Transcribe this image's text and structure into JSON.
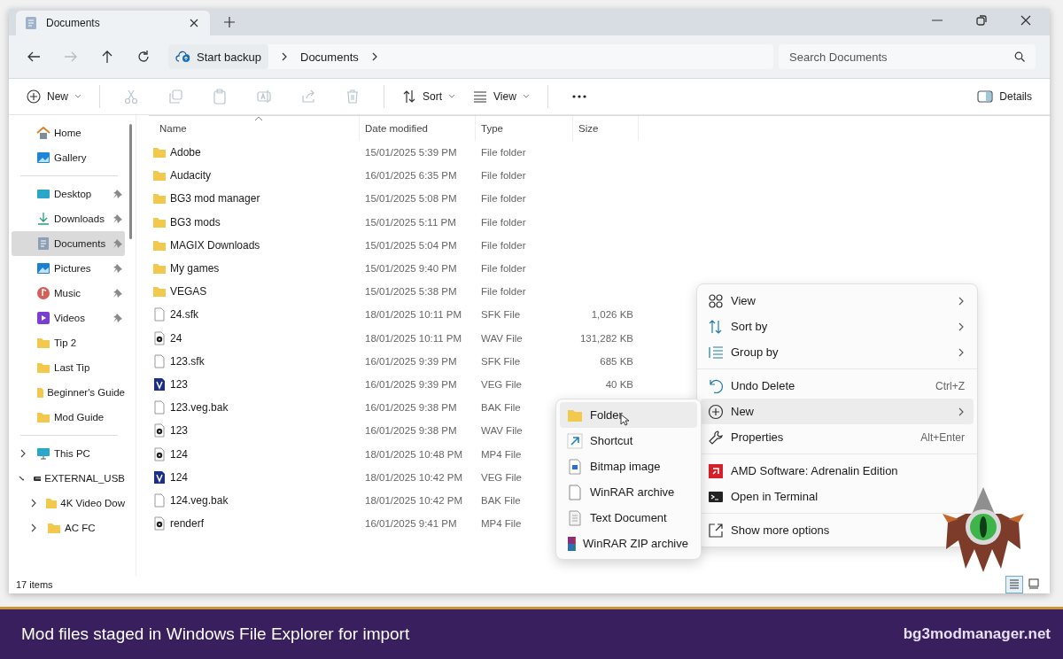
{
  "window": {
    "tabs": [
      {
        "label": "Documents",
        "selected": true
      }
    ]
  },
  "address": {
    "backup": "Start backup",
    "breadcrumbs": [
      "Documents"
    ],
    "search": {
      "placeholder": "Search Documents"
    }
  },
  "toolbar": {
    "new": "New",
    "actions": [
      {
        "kind": "cut",
        "disabled": true
      },
      {
        "kind": "copy",
        "disabled": true
      },
      {
        "kind": "paste",
        "disabled": true
      },
      {
        "kind": "rename",
        "disabled": true
      },
      {
        "kind": "share",
        "disabled": true
      },
      {
        "kind": "delete",
        "disabled": true
      }
    ],
    "sort": "Sort",
    "view": "View",
    "details": "Details"
  },
  "sidebar": {
    "groups": [
      [
        {
          "label": "Home",
          "kind": "home",
          "pinned": false,
          "selected": false
        },
        {
          "label": "Gallery",
          "kind": "gallery",
          "pinned": false,
          "selected": false
        }
      ],
      [
        {
          "label": "Desktop",
          "kind": "desktop",
          "pinned": true,
          "selected": false
        },
        {
          "label": "Downloads",
          "kind": "downloads",
          "pinned": true,
          "selected": false
        },
        {
          "label": "Documents",
          "kind": "documents",
          "pinned": true,
          "selected": true
        },
        {
          "label": "Pictures",
          "kind": "pictures",
          "pinned": true,
          "selected": false
        },
        {
          "label": "Music",
          "kind": "music",
          "pinned": true,
          "selected": false
        },
        {
          "label": "Videos",
          "kind": "videos",
          "pinned": true,
          "selected": false
        },
        {
          "label": "Tip 2",
          "kind": "folder",
          "pinned": false,
          "selected": false
        },
        {
          "label": "Last Tip",
          "kind": "folder",
          "pinned": false,
          "selected": false
        },
        {
          "label": "Beginner's Guide",
          "kind": "folder",
          "pinned": false,
          "selected": false
        },
        {
          "label": "Mod Guide",
          "kind": "folder",
          "pinned": false,
          "selected": false
        }
      ]
    ],
    "tree": [
      {
        "label": "This PC",
        "kind": "pc",
        "expanded": false
      },
      {
        "label": "EXTERNAL_USB",
        "kind": "drive",
        "expanded": true,
        "children": [
          {
            "label": "4K Video Dow",
            "kind": "folder",
            "expanded": false
          },
          {
            "label": "AC FC",
            "kind": "folder",
            "expanded": false
          }
        ]
      }
    ]
  },
  "table": {
    "columns": [
      {
        "label": "Name",
        "sorted": true
      },
      {
        "label": "Date modified",
        "sorted": false
      },
      {
        "label": "Type",
        "sorted": false
      },
      {
        "label": "Size",
        "sorted": false
      }
    ],
    "rows": [
      {
        "name": "Adobe",
        "kind": "folder",
        "date": "15/01/2025 5:39 PM",
        "type": "File folder"
      },
      {
        "name": "Audacity",
        "kind": "folder",
        "date": "16/01/2025 6:35 PM",
        "type": "File folder"
      },
      {
        "name": "BG3 mod manager",
        "kind": "folder",
        "date": "15/01/2025 5:08 PM",
        "type": "File folder"
      },
      {
        "name": "BG3 mods",
        "kind": "folder",
        "date": "15/01/2025 5:11 PM",
        "type": "File folder"
      },
      {
        "name": "MAGIX Downloads",
        "kind": "folder",
        "date": "15/01/2025 5:04 PM",
        "type": "File folder"
      },
      {
        "name": "My games",
        "kind": "folder",
        "date": "15/01/2025 9:40 PM",
        "type": "File folder"
      },
      {
        "name": "VEGAS",
        "kind": "folder",
        "date": "15/01/2025 5:38 PM",
        "type": "File folder"
      },
      {
        "name": "24.sfk",
        "kind": "file",
        "date": "18/01/2025 10:11 PM",
        "type": "SFK File",
        "size": "1,026 KB"
      },
      {
        "name": "24",
        "kind": "media",
        "date": "18/01/2025 10:11 PM",
        "type": "WAV File",
        "size": "131,282 KB"
      },
      {
        "name": "123.sfk",
        "kind": "file",
        "date": "16/01/2025 9:39 PM",
        "type": "SFK File",
        "size": "685 KB"
      },
      {
        "name": "123",
        "kind": "veg",
        "date": "16/01/2025 9:39 PM",
        "type": "VEG File",
        "size": "40 KB"
      },
      {
        "name": "123.veg.bak",
        "kind": "file",
        "date": "16/01/2025 9:38 PM",
        "type": "BAK File"
      },
      {
        "name": "123",
        "kind": "media",
        "date": "16/01/2025 9:38 PM",
        "type": "WAV File"
      },
      {
        "name": "124",
        "kind": "media",
        "date": "18/01/2025 10:48 PM",
        "type": "MP4 File"
      },
      {
        "name": "124",
        "kind": "veg",
        "date": "18/01/2025 10:42 PM",
        "type": "VEG File"
      },
      {
        "name": "124.veg.bak",
        "kind": "file",
        "date": "18/01/2025 10:42 PM",
        "type": "BAK File"
      },
      {
        "name": "renderf",
        "kind": "media",
        "date": "16/01/2025 9:41 PM",
        "type": "MP4 File"
      }
    ]
  },
  "status_bar": {
    "count": "17 items",
    "views": [
      {
        "kind": "details",
        "selected": true
      },
      {
        "kind": "tiles",
        "selected": false
      }
    ]
  },
  "context_menu": {
    "groups": [
      [
        {
          "label": "View",
          "kind": "grid",
          "submenu": true,
          "selected": false
        },
        {
          "label": "Sort by",
          "kind": "sort",
          "submenu": true,
          "selected": false
        },
        {
          "label": "Group by",
          "kind": "group",
          "submenu": true,
          "selected": false
        }
      ],
      [
        {
          "label": "Undo Delete",
          "kind": "undo",
          "shortcut": "Ctrl+Z",
          "submenu": false,
          "selected": false
        },
        {
          "label": "New",
          "kind": "new",
          "submenu": true,
          "selected": true
        },
        {
          "label": "Properties",
          "kind": "wrench",
          "shortcut": "Alt+Enter",
          "submenu": false,
          "selected": false
        }
      ],
      [
        {
          "label": "AMD Software: Adrenalin Edition",
          "kind": "amd",
          "submenu": false,
          "selected": false
        },
        {
          "label": "Open in Terminal",
          "kind": "terminal",
          "submenu": false,
          "selected": false
        }
      ],
      [
        {
          "label": "Show more options",
          "kind": "more",
          "submenu": false,
          "selected": false
        }
      ]
    ]
  },
  "new_submenu": [
    {
      "label": "Folder",
      "kind": "folder",
      "selected": true
    },
    {
      "label": "Shortcut",
      "kind": "shortcut",
      "selected": false
    },
    {
      "label": "Bitmap image",
      "kind": "bitmap",
      "selected": false
    },
    {
      "label": "WinRAR archive",
      "kind": "file",
      "selected": false
    },
    {
      "label": "Text Document",
      "kind": "text",
      "selected": false
    },
    {
      "label": "WinRAR ZIP archive",
      "kind": "zip",
      "selected": false
    }
  ],
  "banner": {
    "caption": "Mod files staged in Windows File Explorer for import",
    "site": "bg3modmanager.net"
  }
}
